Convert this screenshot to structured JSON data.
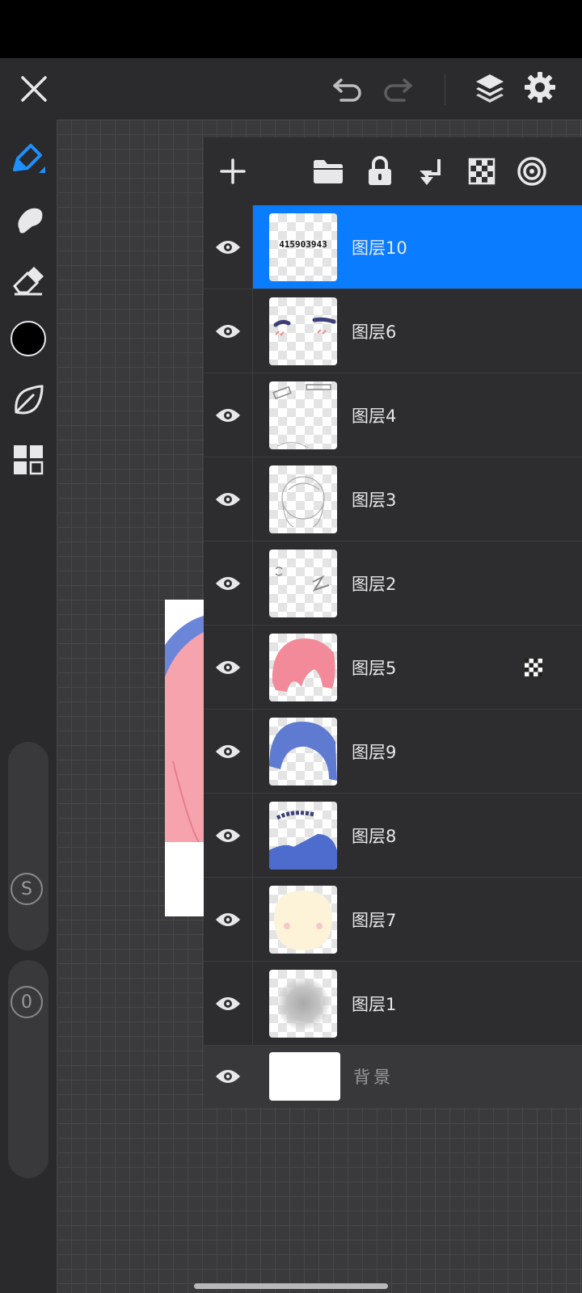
{
  "colors": {
    "accent": "#0a7cff",
    "panel": "#2d2d2f",
    "canvas": "#3a3a3c",
    "current_brush_color": "#000000"
  },
  "top_bar": {
    "close_icon": "close-icon",
    "undo_icon": "undo-icon",
    "redo_icon": "redo-icon",
    "layers_icon": "layers-icon",
    "settings_icon": "gear-icon"
  },
  "left_toolbar": {
    "tools": [
      "pen-icon",
      "smudge-icon",
      "eraser-icon",
      "color-swatch",
      "leaf-icon",
      "grid-icon"
    ],
    "size_slider_label": "S",
    "opacity_slider_label": "0"
  },
  "layers_panel": {
    "toolbar_icons": [
      "plus-icon",
      "folder-icon",
      "lock-icon",
      "merge-down-icon",
      "checker-icon",
      "blend-icon"
    ],
    "layers": [
      {
        "name": "图层10",
        "selected": true,
        "thumb_text": "415903943"
      },
      {
        "name": "图层6",
        "selected": false
      },
      {
        "name": "图层4",
        "selected": false
      },
      {
        "name": "图层3",
        "selected": false
      },
      {
        "name": "图层2",
        "selected": false
      },
      {
        "name": "图层5",
        "selected": false,
        "alpha_locked": true
      },
      {
        "name": "图层9",
        "selected": false
      },
      {
        "name": "图层8",
        "selected": false
      },
      {
        "name": "图层7",
        "selected": false
      },
      {
        "name": "图层1",
        "selected": false
      }
    ],
    "background_label": "背景"
  }
}
